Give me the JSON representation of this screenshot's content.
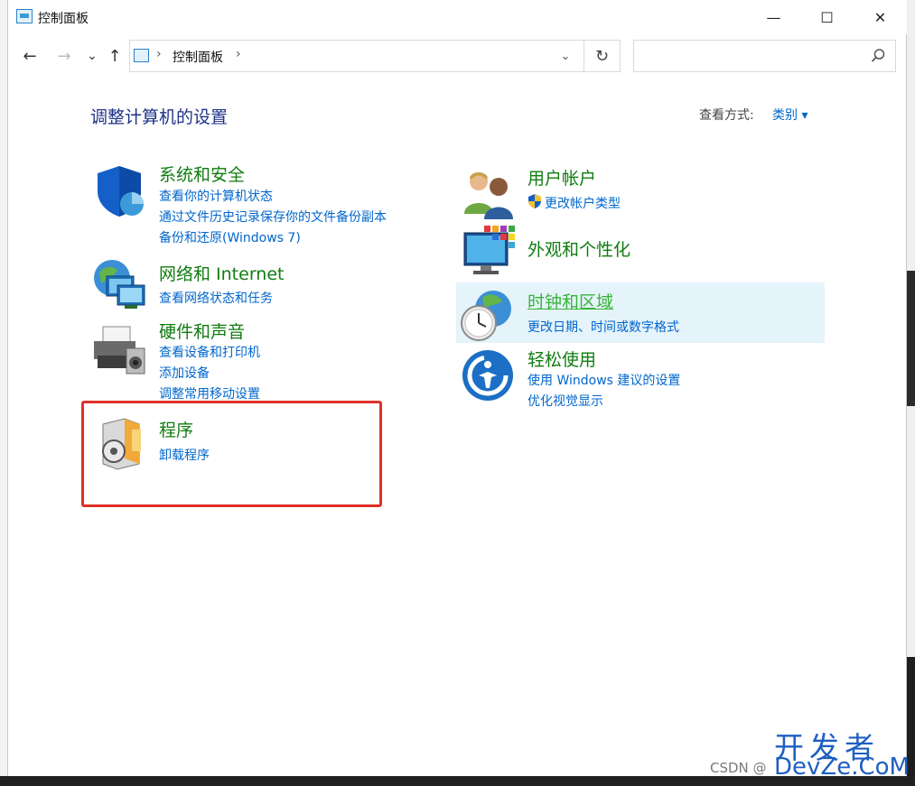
{
  "window": {
    "title": "控制面板",
    "minimize_glyph": "—",
    "maximize_glyph": "☐",
    "close_glyph": "✕"
  },
  "nav": {
    "back_glyph": "←",
    "forward_glyph": "→",
    "recent_glyph": "⌄",
    "up_glyph": "↑",
    "breadcrumb": "控制面板",
    "chevron_glyph": "›",
    "dropdown_glyph": "⌄",
    "refresh_glyph": "↻",
    "search_placeholder": ""
  },
  "content": {
    "heading": "调整计算机的设置",
    "view_by_label": "查看方式:",
    "view_by_value": "类别 ▾"
  },
  "categories": {
    "system_security": {
      "icon": "shield-icon",
      "title": "系统和安全",
      "links": [
        "查看你的计算机状态",
        "通过文件历史记录保存你的文件备份副本",
        "备份和还原(Windows 7)"
      ]
    },
    "network": {
      "icon": "network-globe-icon",
      "title": "网络和 Internet",
      "links": [
        "查看网络状态和任务"
      ]
    },
    "hardware_sound": {
      "icon": "printer-icon",
      "title": "硬件和声音",
      "links": [
        "查看设备和打印机",
        "添加设备",
        "调整常用移动设置"
      ]
    },
    "programs": {
      "icon": "program-disc-icon",
      "title": "程序",
      "links": [
        "卸载程序"
      ]
    },
    "user_accounts": {
      "icon": "users-icon",
      "title": "用户帐户",
      "links": [
        "更改帐户类型"
      ]
    },
    "appearance": {
      "icon": "monitor-personalize-icon",
      "title": "外观和个性化",
      "links": []
    },
    "clock_region": {
      "icon": "clock-globe-icon",
      "title": "时钟和区域",
      "links": [
        "更改日期、时间或数字格式"
      ]
    },
    "ease_of_access": {
      "icon": "ease-of-access-icon",
      "title": "轻松使用",
      "links": [
        "使用 Windows 建议的设置",
        "优化视觉显示"
      ]
    }
  },
  "watermark": {
    "brand_cn": "开发者",
    "brand_en": "DevZe.CoM",
    "source": "CSDN @"
  },
  "colors": {
    "category_title": "#107c10",
    "link": "#0066cc",
    "heading": "#1e3287",
    "hover_bg": "#e5f3fb",
    "highlight_border": "#e0302a"
  }
}
